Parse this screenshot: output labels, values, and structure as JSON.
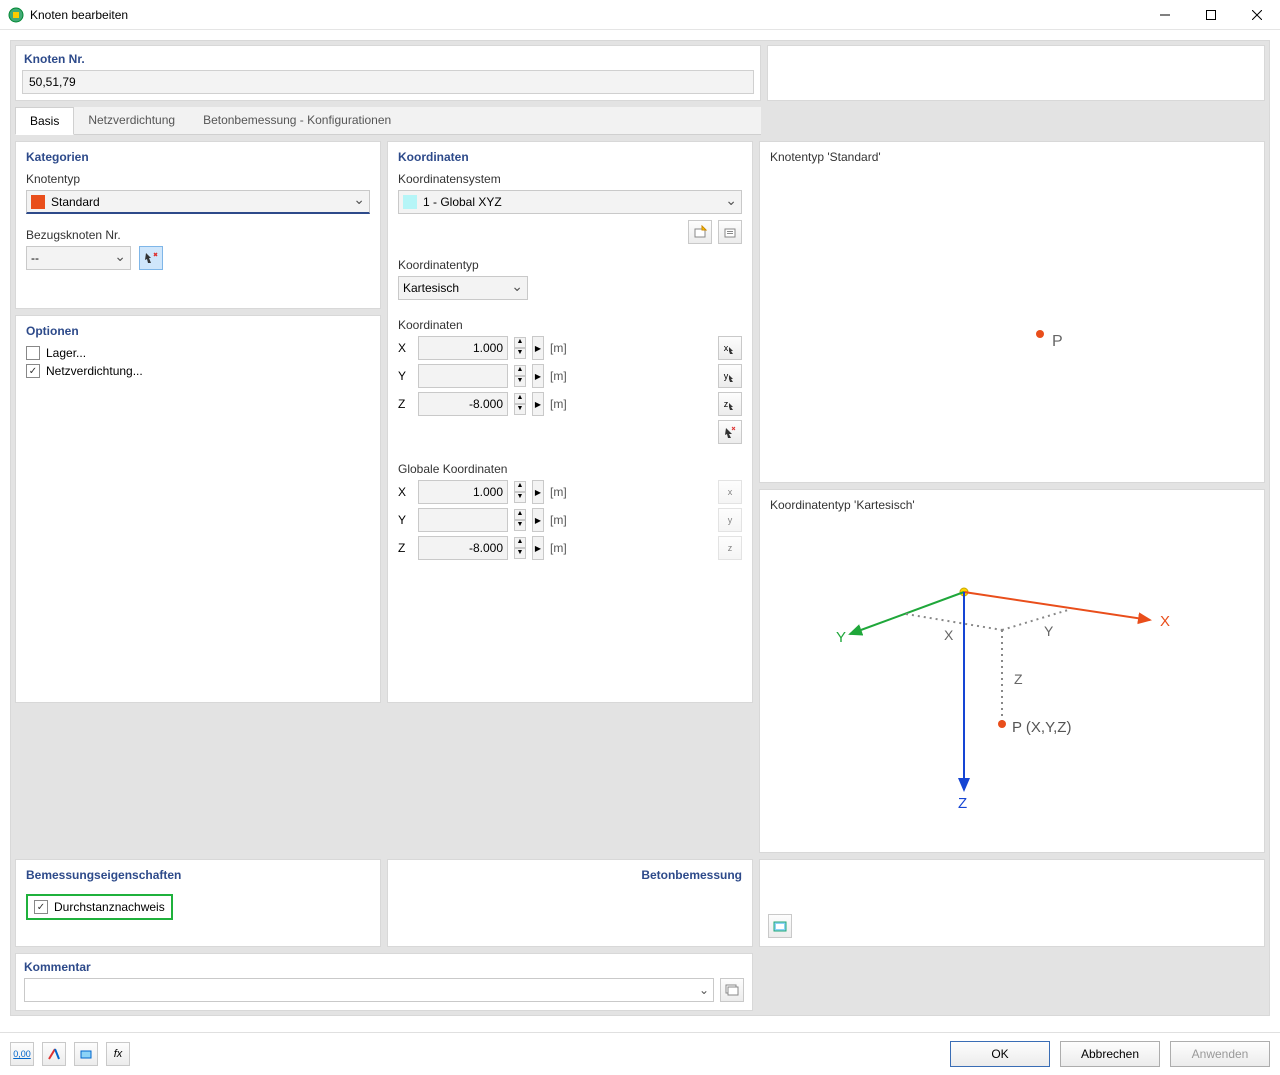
{
  "window": {
    "title": "Knoten bearbeiten"
  },
  "header": {
    "node_nr_label": "Knoten Nr.",
    "node_nr_value": "50,51,79"
  },
  "tabs": {
    "basis": "Basis",
    "mesh": "Netzverdichtung",
    "concrete": "Betonbemessung - Konfigurationen"
  },
  "categories": {
    "title": "Kategorien",
    "nodetype_label": "Knotentyp",
    "nodetype_value": "Standard",
    "refnode_label": "Bezugsknoten Nr.",
    "refnode_value": "--"
  },
  "options": {
    "title": "Optionen",
    "support": "Lager...",
    "meshref": "Netzverdichtung..."
  },
  "coords": {
    "title": "Koordinaten",
    "system_label": "Koordinatensystem",
    "system_value": "1 - Global XYZ",
    "type_label": "Koordinatentyp",
    "type_value": "Kartesisch",
    "coords_label": "Koordinaten",
    "x": "X",
    "y": "Y",
    "z": "Z",
    "xv": "1.000",
    "yv": "",
    "zv": "-8.000",
    "unit": "[m]",
    "global_label": "Globale Koordinaten",
    "gxv": "1.000",
    "gyv": "",
    "gzv": "-8.000"
  },
  "design": {
    "left_title": "Bemessungseigenschaften",
    "right_title": "Betonbemessung",
    "punch": "Durchstanznachweis"
  },
  "comment": {
    "title": "Kommentar"
  },
  "preview": {
    "type_label": "Knotentyp 'Standard'",
    "coord_label": "Koordinatentyp 'Kartesisch'",
    "p": "P",
    "pxyz": "P (X,Y,Z)",
    "ax_x": "X",
    "ax_y": "Y",
    "ax_z": "Z"
  },
  "buttons": {
    "ok": "OK",
    "cancel": "Abbrechen",
    "apply": "Anwenden"
  }
}
